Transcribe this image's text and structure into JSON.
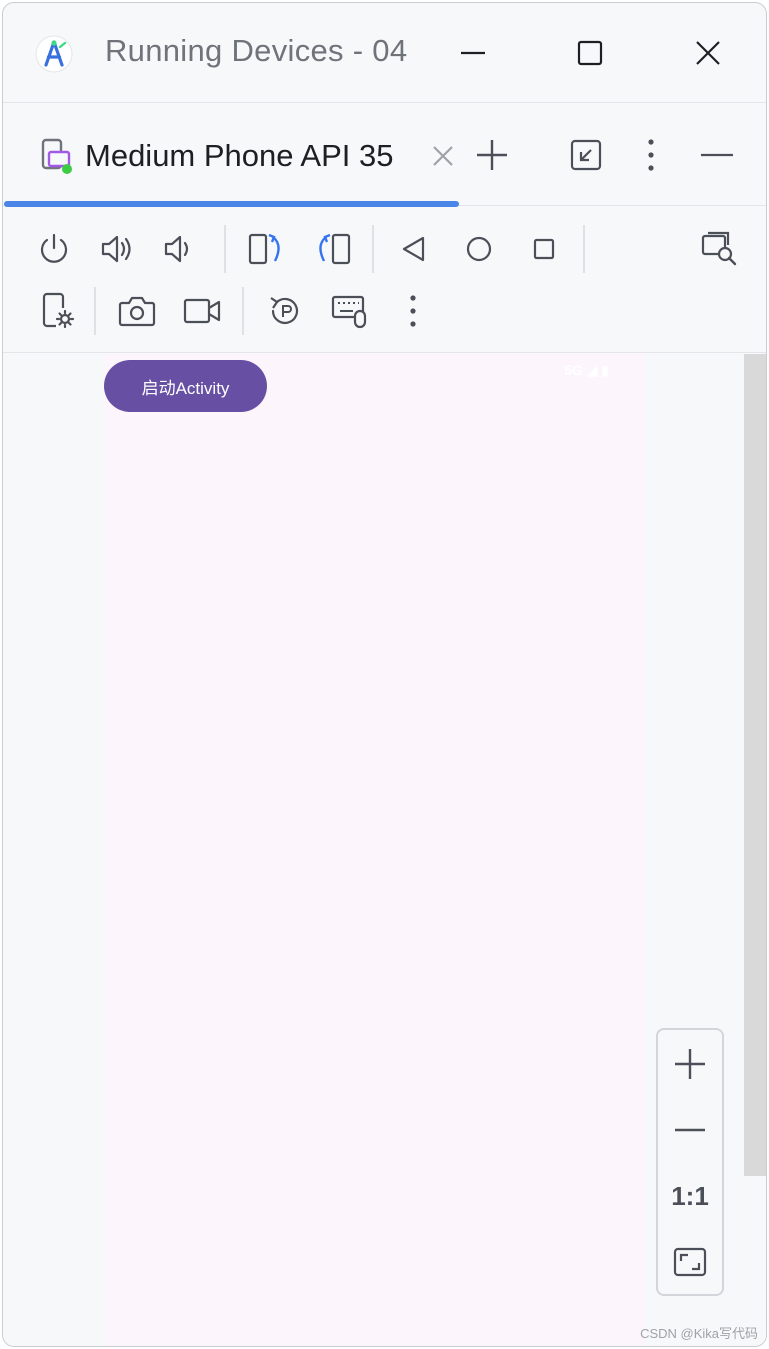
{
  "window": {
    "title": "Running Devices - 04",
    "icons": {
      "app": "android-studio-icon",
      "minimize": "minimize-icon",
      "maximize": "maximize-icon",
      "close": "close-icon"
    }
  },
  "tabs": [
    {
      "label": "Medium Phone API 35",
      "icon": "running-device-icon",
      "active": true
    }
  ],
  "tabbar_actions": [
    "new-tab-icon",
    "restore-window-icon",
    "more-vert-icon",
    "hide-panel-icon"
  ],
  "toolbar": {
    "row1": [
      "power-icon",
      "volume-up-icon",
      "volume-down-icon",
      "rotate-left-icon",
      "rotate-right-icon",
      "back-icon",
      "home-icon",
      "overview-icon",
      "inspect-device-icon"
    ],
    "row2": [
      "device-settings-icon",
      "screenshot-icon",
      "screen-record-icon",
      "reset-icon",
      "keyboard-mouse-icon",
      "more-vert-icon"
    ]
  },
  "device": {
    "button_label": "启动Activity",
    "status_text": "5G ◢ ▮",
    "background_color": "#fcf6fc",
    "button_color": "#6750a4"
  },
  "zoom": {
    "one_to_one": "1:1",
    "icons": [
      "zoom-in-icon",
      "zoom-out-icon",
      "fit-screen-icon"
    ]
  },
  "watermark": "CSDN @Kika写代码",
  "colors": {
    "accent": "#4a86e8",
    "icon": "#4b4f57"
  }
}
